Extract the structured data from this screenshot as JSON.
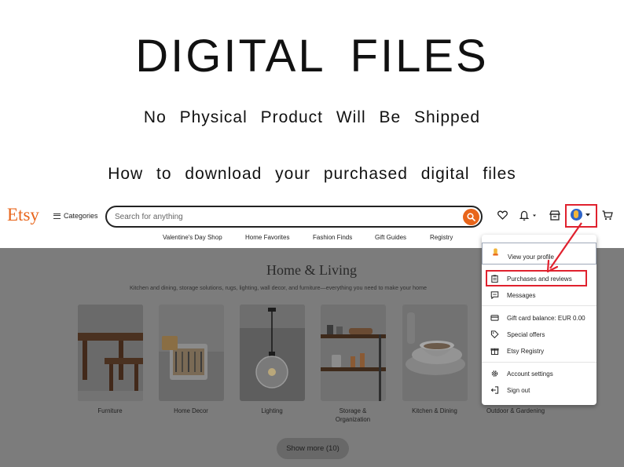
{
  "heading": {
    "title": "DIGITAL FILES",
    "subtitle": "No Physical Product Will Be Shipped",
    "instruction": "How to download your purchased digital files"
  },
  "header": {
    "logo": "Etsy",
    "categories_label": "Categories",
    "search_placeholder": "Search for anything",
    "icons": [
      "search-icon",
      "heart-icon",
      "bell-icon",
      "shop-icon",
      "avatar",
      "cart-icon"
    ]
  },
  "subnav": {
    "items": [
      "Valentine's Day Shop",
      "Home Favorites",
      "Fashion Finds",
      "Gift Guides",
      "Registry"
    ]
  },
  "section": {
    "title": "Home & Living",
    "subtitle": "Kitchen and dining, storage solutions, rugs, lighting, wall decor, and furniture—everything you need to make your home",
    "categories": [
      "Furniture",
      "Home Decor",
      "Lighting",
      "Storage &\nOrganization",
      "Kitchen & Dining",
      "Outdoor & Gardening"
    ],
    "show_more": "Show more (10)"
  },
  "dropdown": {
    "items": [
      {
        "label": "View your profile",
        "icon": "profile-icon"
      },
      {
        "label": "Purchases and reviews",
        "icon": "clipboard-icon"
      },
      {
        "label": "Messages",
        "icon": "message-icon"
      },
      {
        "label": "Gift card balance: EUR 0.00",
        "icon": "card-icon"
      },
      {
        "label": "Special offers",
        "icon": "tag-icon"
      },
      {
        "label": "Etsy Registry",
        "icon": "gift-icon"
      },
      {
        "label": "Account settings",
        "icon": "gear-icon"
      },
      {
        "label": "Sign out",
        "icon": "sign-out-icon"
      }
    ]
  },
  "colors": {
    "brand": "#e8651b",
    "highlight": "#e0212e",
    "avatar": "#2f65c9",
    "overlay": "#7c7c7c"
  }
}
